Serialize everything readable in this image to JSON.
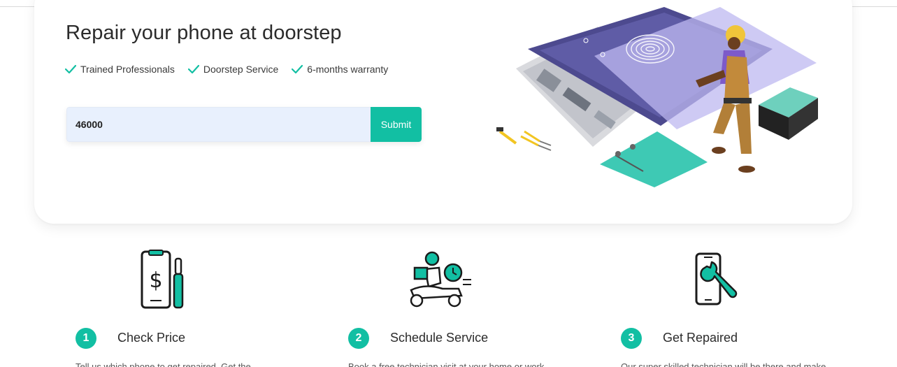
{
  "hero": {
    "title": "Repair your phone at doorstep",
    "features": [
      {
        "icon": "check-icon",
        "label": "Trained Professionals"
      },
      {
        "icon": "check-icon",
        "label": "Doorstep Service"
      },
      {
        "icon": "check-icon",
        "label": "6-months warranty"
      }
    ],
    "zip_value": "46000",
    "submit_label": "Submit"
  },
  "steps": [
    {
      "number": "1",
      "title": "Check Price",
      "icon": "phone-price-icon",
      "desc": "Tell us which phone to get repaired. Get the"
    },
    {
      "number": "2",
      "title": "Schedule Service",
      "icon": "delivery-scooter-icon",
      "desc": "Book a free technician visit at your home or work"
    },
    {
      "number": "3",
      "title": "Get Repaired",
      "icon": "phone-wrench-icon",
      "desc": "Our super skilled technician will be there and make"
    }
  ],
  "colors": {
    "accent": "#12bfa3",
    "input_bg": "#e8f0fd",
    "phone_purple": "#4d4a8f"
  }
}
